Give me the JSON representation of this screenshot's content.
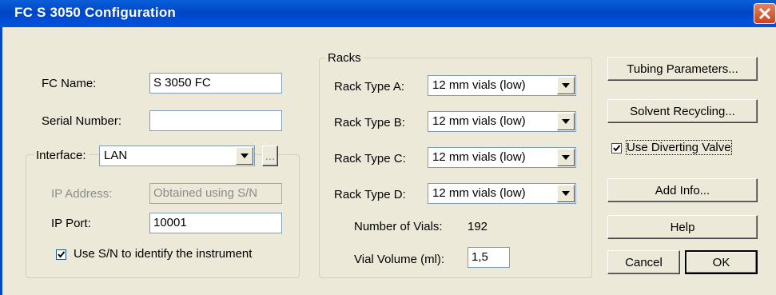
{
  "window": {
    "title": "FC S 3050 Configuration"
  },
  "fc_name": {
    "label": "FC Name:",
    "value": "S 3050 FC"
  },
  "serial_number": {
    "label": "Serial Number:",
    "value": ""
  },
  "interface": {
    "label": "Interface:",
    "value": "LAN",
    "browse_label": "..."
  },
  "ip_address": {
    "label": "IP Address:",
    "value": "Obtained using S/N"
  },
  "ip_port": {
    "label": "IP Port:",
    "value": "10001"
  },
  "use_sn": {
    "label": "Use S/N to identify the instrument",
    "checked": true
  },
  "racks": {
    "title": "Racks",
    "rack_a": {
      "label": "Rack Type A:",
      "value": "12 mm vials (low)"
    },
    "rack_b": {
      "label": "Rack Type B:",
      "value": "12 mm vials (low)"
    },
    "rack_c": {
      "label": "Rack Type C:",
      "value": "12 mm vials (low)"
    },
    "rack_d": {
      "label": "Rack Type D:",
      "value": "12 mm vials (low)"
    },
    "num_vials": {
      "label": "Number of Vials:",
      "value": "192"
    },
    "vial_volume": {
      "label": "Vial Volume (ml):",
      "value": "1,5"
    }
  },
  "buttons": {
    "tubing": "Tubing Parameters...",
    "solvent": "Solvent Recycling...",
    "add_info": "Add Info...",
    "help": "Help",
    "cancel": "Cancel",
    "ok": "OK"
  },
  "diverting_valve": {
    "label": "Use Diverting Valve",
    "checked": true
  }
}
